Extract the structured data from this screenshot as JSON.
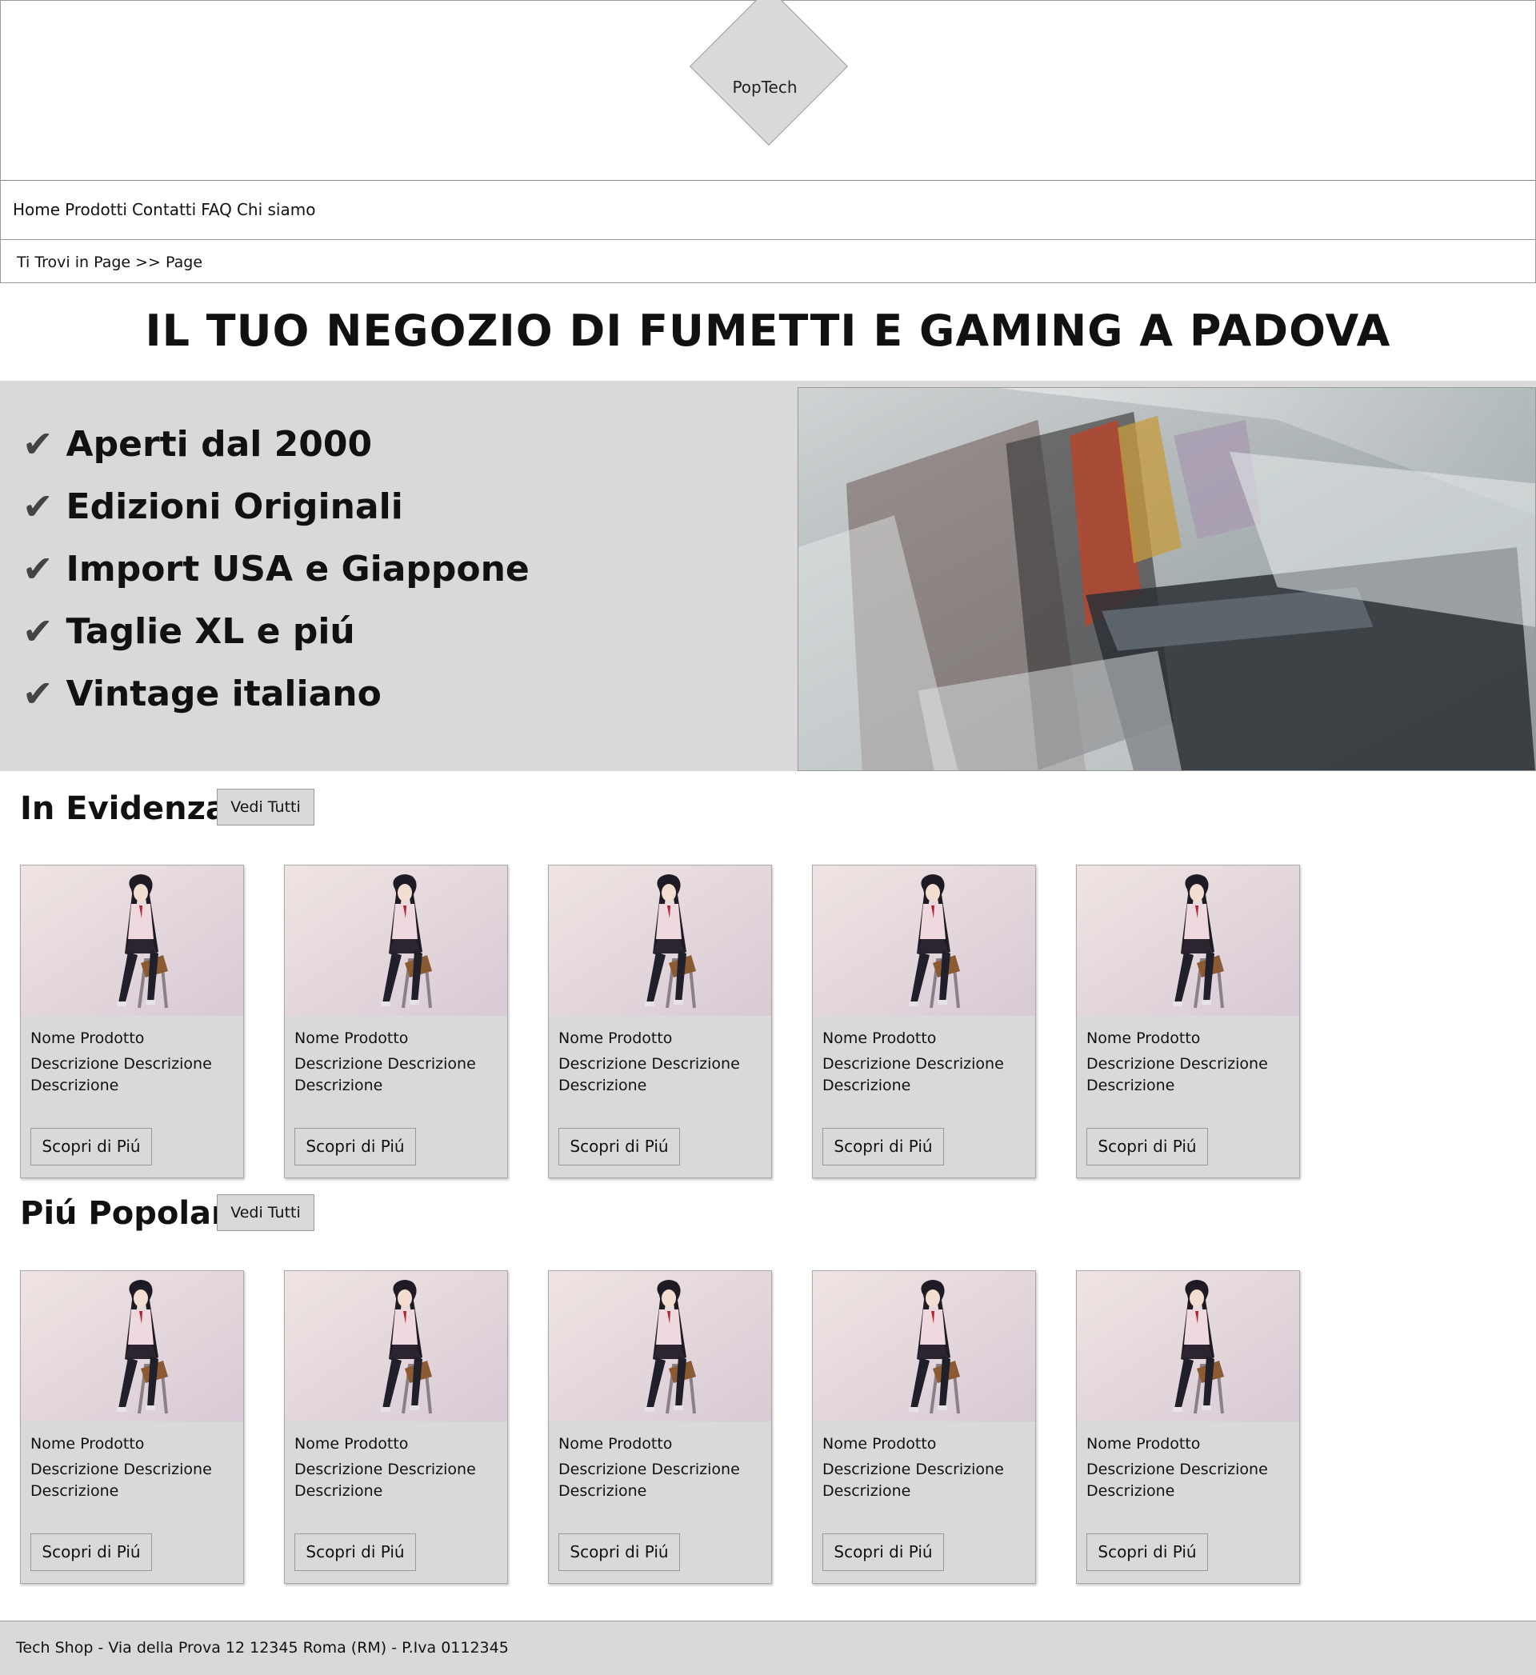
{
  "header": {
    "logo_text": "PopTech"
  },
  "nav": {
    "items": [
      "Home",
      "Prodotti",
      "Contatti",
      "FAQ",
      "Chi siamo"
    ]
  },
  "breadcrumb": {
    "text": "Ti Trovi in Page >> Page"
  },
  "headline": "IL TUO NEGOZIO DI FUMETTI E GAMING A PADOVA",
  "hero": {
    "check_glyph": "✔",
    "features": [
      "Aperti dal 2000",
      "Edizioni Originali",
      "Import USA e Giappone",
      "Taglie XL e piú",
      "Vintage italiano"
    ]
  },
  "sections": [
    {
      "title": "In Evidenza",
      "button": "Vedi Tutti",
      "products": [
        {
          "name": "Nome Prodotto",
          "desc": "Descrizione Descrizione Descrizione",
          "button": "Scopri di Piú"
        },
        {
          "name": "Nome Prodotto",
          "desc": "Descrizione Descrizione Descrizione",
          "button": "Scopri di Piú"
        },
        {
          "name": "Nome Prodotto",
          "desc": "Descrizione Descrizione Descrizione",
          "button": "Scopri di Piú"
        },
        {
          "name": "Nome Prodotto",
          "desc": "Descrizione Descrizione Descrizione",
          "button": "Scopri di Piú"
        },
        {
          "name": "Nome Prodotto",
          "desc": "Descrizione Descrizione Descrizione",
          "button": "Scopri di Piú"
        }
      ]
    },
    {
      "title": "Piú Popolari",
      "button": "Vedi Tutti",
      "products": [
        {
          "name": "Nome Prodotto",
          "desc": "Descrizione Descrizione Descrizione",
          "button": "Scopri di Piú"
        },
        {
          "name": "Nome Prodotto",
          "desc": "Descrizione Descrizione Descrizione",
          "button": "Scopri di Piú"
        },
        {
          "name": "Nome Prodotto",
          "desc": "Descrizione Descrizione Descrizione",
          "button": "Scopri di Piú"
        },
        {
          "name": "Nome Prodotto",
          "desc": "Descrizione Descrizione Descrizione",
          "button": "Scopri di Piú"
        },
        {
          "name": "Nome Prodotto",
          "desc": "Descrizione Descrizione Descrizione",
          "button": "Scopri di Piú"
        }
      ]
    }
  ],
  "footer": {
    "text": "Tech Shop - Via della Prova 12 12345 Roma (RM) - P.Iva 0112345"
  },
  "colors": {
    "panel_gray": "#d9d9d9",
    "border": "#999999"
  }
}
